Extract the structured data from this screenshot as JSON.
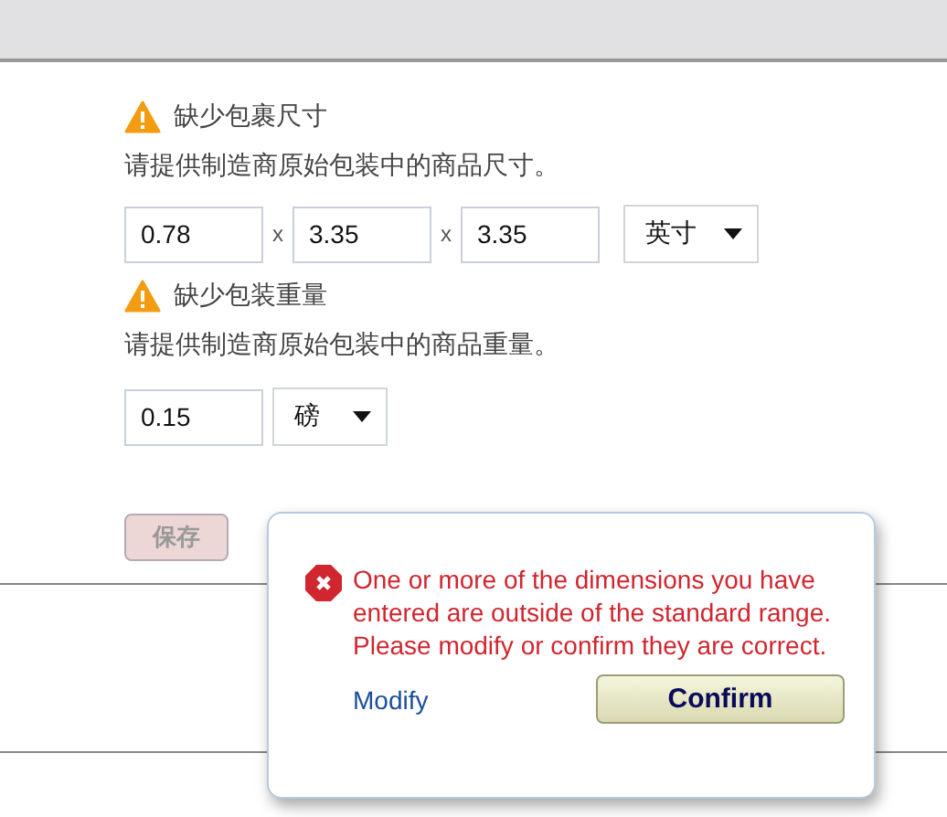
{
  "dimensions": {
    "warning": "缺少包裹尺寸",
    "hint": "请提供制造商原始包装中的商品尺寸。",
    "values": [
      "0.78",
      "3.35",
      "3.35"
    ],
    "separators": [
      "x",
      "x"
    ],
    "unit": "英寸"
  },
  "weight": {
    "warning": "缺少包装重量",
    "hint": "请提供制造商原始包装中的商品重量。",
    "value": "0.15",
    "unit": "磅"
  },
  "save_button": {
    "label": "保存",
    "disabled": true
  },
  "popup": {
    "message": "One or more of the dimensions you have entered are outside of the standard range. Please modify or confirm they are correct.",
    "modify_link": "Modify",
    "confirm_button": "Confirm"
  }
}
